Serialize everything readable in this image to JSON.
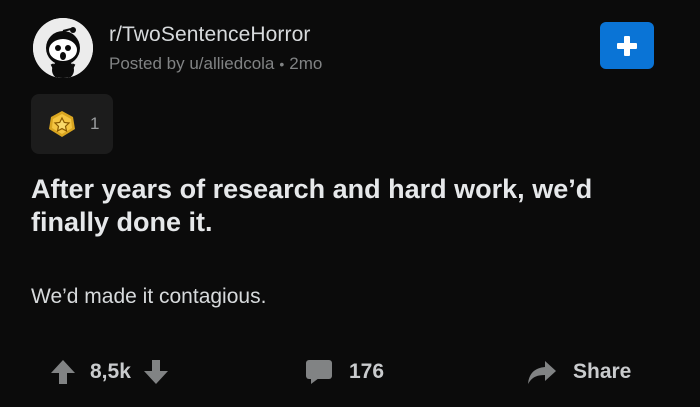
{
  "post": {
    "subreddit": "r/TwoSentenceHorror",
    "posted_by": "Posted by u/alliedcola",
    "separator": "•",
    "age": "2mo",
    "award_count": "1",
    "title": "After years of research and hard work, we’d finally done it.",
    "body": "We’d made it contagious."
  },
  "actions": {
    "score": "8,5k",
    "comment_count": "176",
    "share_label": "Share"
  },
  "colors": {
    "background": "#0b0b0b",
    "join_button": "#0a74d6",
    "award_bg": "#1c1c1c",
    "muted_text": "#818384"
  },
  "icons": {
    "join": "plus-icon",
    "award": "gold-award-icon",
    "upvote": "upvote-arrow-icon",
    "downvote": "downvote-arrow-icon",
    "comment": "comment-bubble-icon",
    "share": "share-arrow-icon"
  }
}
